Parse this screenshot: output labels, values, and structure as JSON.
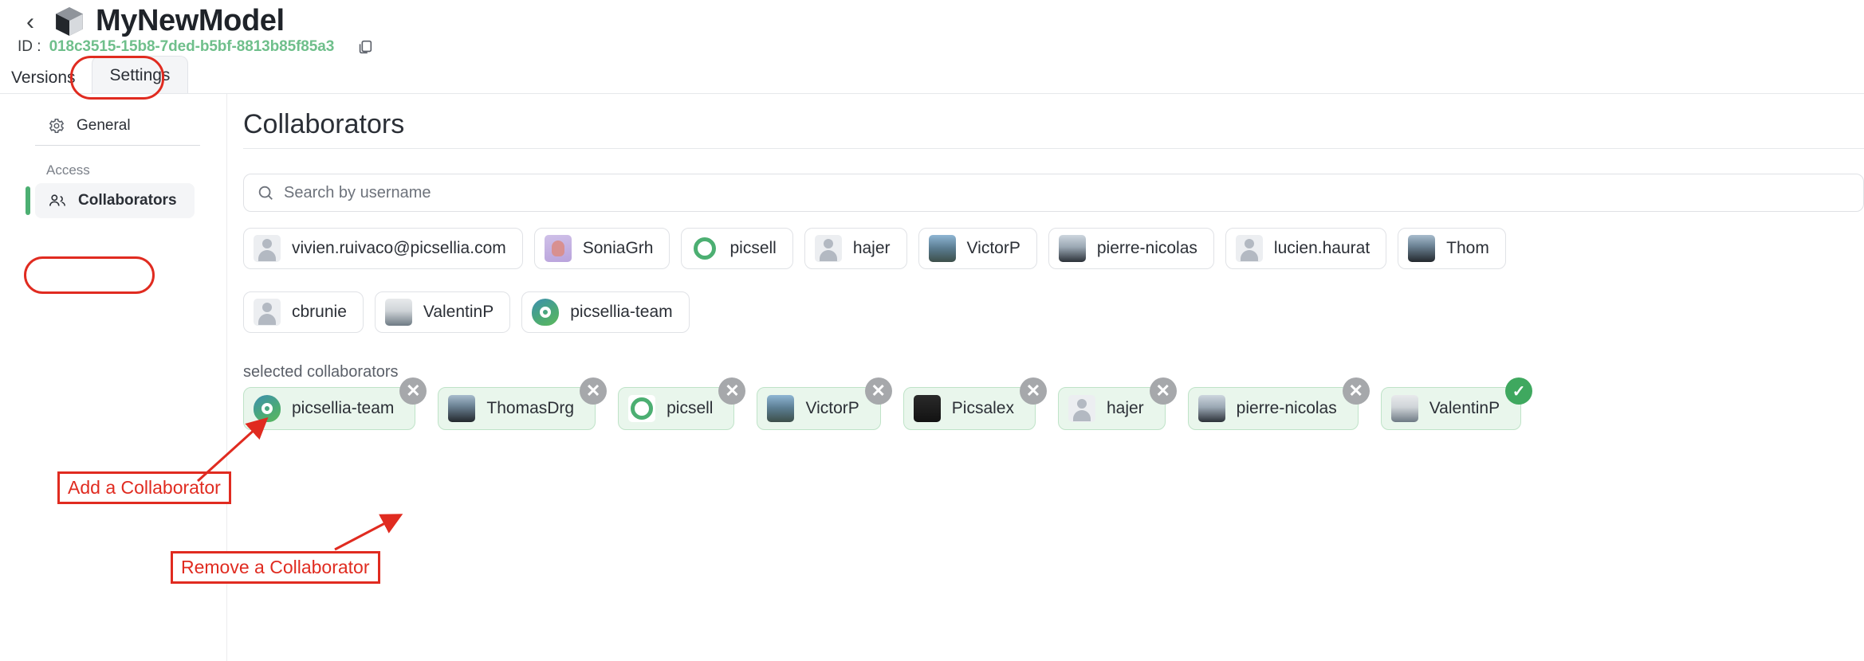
{
  "header": {
    "back_icon": "chevron-left-icon",
    "model_icon": "cube-icon",
    "title": "MyNewModel",
    "id_label": "ID :",
    "id_value": "018c3515-15b8-7ded-b5bf-8813b85f85a3",
    "copy_icon": "copy-icon"
  },
  "tabs": [
    {
      "label": "Versions",
      "active": false
    },
    {
      "label": "Settings",
      "active": true
    }
  ],
  "sidebar": {
    "general": {
      "label": "General",
      "icon": "gear-icon"
    },
    "section_label": "Access",
    "collaborators": {
      "label": "Collaborators",
      "icon": "users-icon"
    }
  },
  "main": {
    "title": "Collaborators",
    "search": {
      "placeholder": "Search by username",
      "icon": "search-icon",
      "value": ""
    },
    "selected_label": "selected collaborators"
  },
  "available": [
    {
      "name": "vivien.ruivaco@picsellia.com",
      "avatar": "default"
    },
    {
      "name": "SoniaGrh",
      "avatar": "p1"
    },
    {
      "name": "picsell",
      "avatar": "ring"
    },
    {
      "name": "hajer",
      "avatar": "default"
    },
    {
      "name": "VictorP",
      "avatar": "p2"
    },
    {
      "name": "pierre-nicolas",
      "avatar": "p3"
    },
    {
      "name": "lucien.haurat",
      "avatar": "default"
    },
    {
      "name": "Thom",
      "avatar": "p4"
    },
    {
      "name": "cbrunie",
      "avatar": "default"
    },
    {
      "name": "ValentinP",
      "avatar": "p5"
    },
    {
      "name": "picsellia-team",
      "avatar": "teamlogo"
    }
  ],
  "selected": [
    {
      "name": "picsellia-team",
      "avatar": "teamlogo",
      "badge": "remove"
    },
    {
      "name": "ThomasDrg",
      "avatar": "p4",
      "badge": "remove"
    },
    {
      "name": "picsell",
      "avatar": "ring",
      "badge": "remove"
    },
    {
      "name": "VictorP",
      "avatar": "p2",
      "badge": "remove"
    },
    {
      "name": "Picsalex",
      "avatar": "p6",
      "badge": "remove"
    },
    {
      "name": "hajer",
      "avatar": "default",
      "badge": "remove"
    },
    {
      "name": "pierre-nicolas",
      "avatar": "p3",
      "badge": "remove"
    },
    {
      "name": "ValentinP",
      "avatar": "p5",
      "badge": "check"
    }
  ],
  "annotations": {
    "add": "Add a Collaborator",
    "remove": "Remove a Collaborator",
    "color": "#e02b20"
  }
}
